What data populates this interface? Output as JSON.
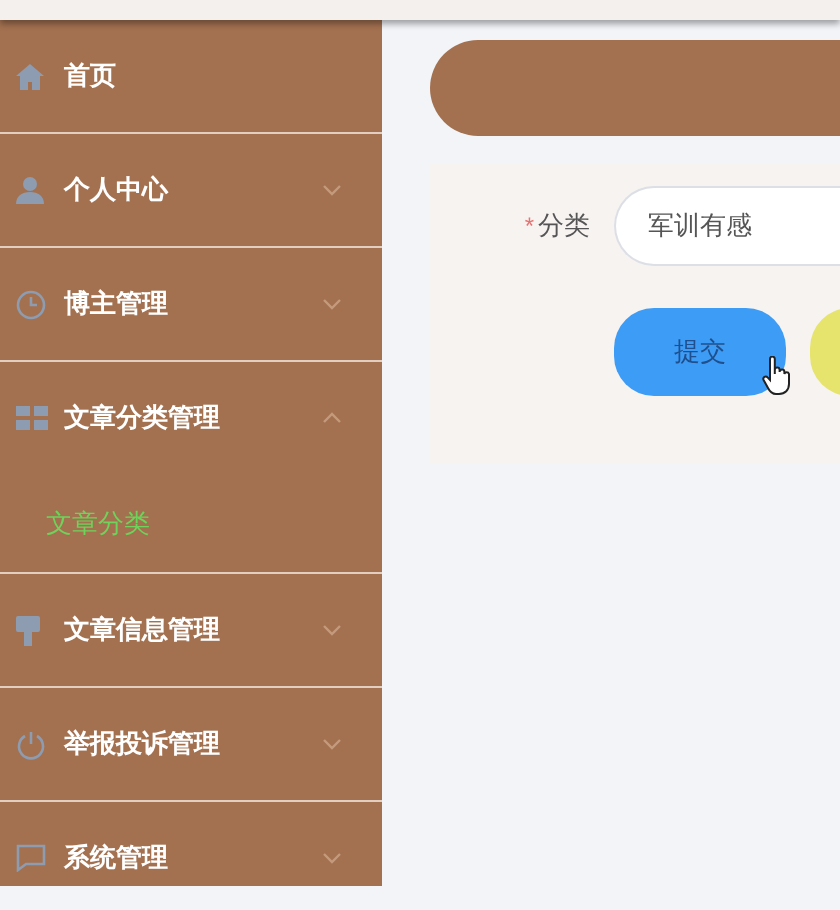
{
  "sidebar": {
    "items": [
      {
        "label": "首页"
      },
      {
        "label": "个人中心",
        "expanded": false
      },
      {
        "label": "博主管理",
        "expanded": false
      },
      {
        "label": "文章分类管理",
        "expanded": true,
        "children": [
          {
            "label": "文章分类",
            "selected": true
          }
        ]
      },
      {
        "label": "文章信息管理",
        "expanded": false
      },
      {
        "label": "举报投诉管理",
        "expanded": false
      },
      {
        "label": "系统管理",
        "expanded": false
      }
    ]
  },
  "form": {
    "fields": [
      {
        "label": "分类",
        "required_mark": "*",
        "value": "军训有感"
      }
    ],
    "buttons": [
      {
        "kind": "primary",
        "label": "提交"
      },
      {
        "kind": "secondary"
      }
    ]
  }
}
